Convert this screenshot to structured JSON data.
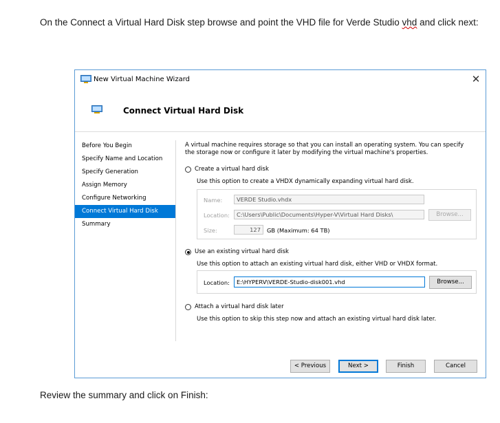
{
  "doc": {
    "intro_before": "On the Connect a Virtual Hard Disk step browse and point the VHD file for Verde Studio ",
    "intro_squiggle": "vhd",
    "intro_after": " and click next:",
    "outro": "Review the summary and click on Finish:"
  },
  "window": {
    "title": "New Virtual Machine Wizard",
    "close_glyph": "✕",
    "header_title": "Connect Virtual Hard Disk"
  },
  "nav": {
    "items": [
      {
        "label": "Before You Begin"
      },
      {
        "label": "Specify Name and Location"
      },
      {
        "label": "Specify Generation"
      },
      {
        "label": "Assign Memory"
      },
      {
        "label": "Configure Networking"
      },
      {
        "label": "Connect Virtual Hard Disk",
        "active": true
      },
      {
        "label": "Summary"
      }
    ]
  },
  "content": {
    "description": "A virtual machine requires storage so that you can install an operating system. You can specify the storage now or configure it later by modifying the virtual machine's properties.",
    "option_create": {
      "label": "Create a virtual hard disk",
      "desc": "Use this option to create a VHDX dynamically expanding virtual hard disk.",
      "name_label": "Name:",
      "name_value": "VERDE Studio.vhdx",
      "location_label": "Location:",
      "location_value": "C:\\Users\\Public\\Documents\\Hyper-V\\Virtual Hard Disks\\",
      "browse_label": "Browse...",
      "size_label": "Size:",
      "size_value": "127",
      "size_suffix": "GB (Maximum: 64 TB)"
    },
    "option_existing": {
      "label": "Use an existing virtual hard disk",
      "desc": "Use this option to attach an existing virtual hard disk, either VHD or VHDX format.",
      "location_label": "Location:",
      "location_value": "E:\\HYPERV\\VERDE-Studio-disk001.vhd",
      "browse_label": "Browse..."
    },
    "option_later": {
      "label": "Attach a virtual hard disk later",
      "desc": "Use this option to skip this step now and attach an existing virtual hard disk later."
    }
  },
  "footer": {
    "previous": "< Previous",
    "next": "Next >",
    "finish": "Finish",
    "cancel": "Cancel"
  },
  "colors": {
    "accent": "#0078d7",
    "window_border": "#5a9bd5"
  },
  "icons": [
    "app-window-icon",
    "close-icon",
    "hard-disk-icon"
  ]
}
